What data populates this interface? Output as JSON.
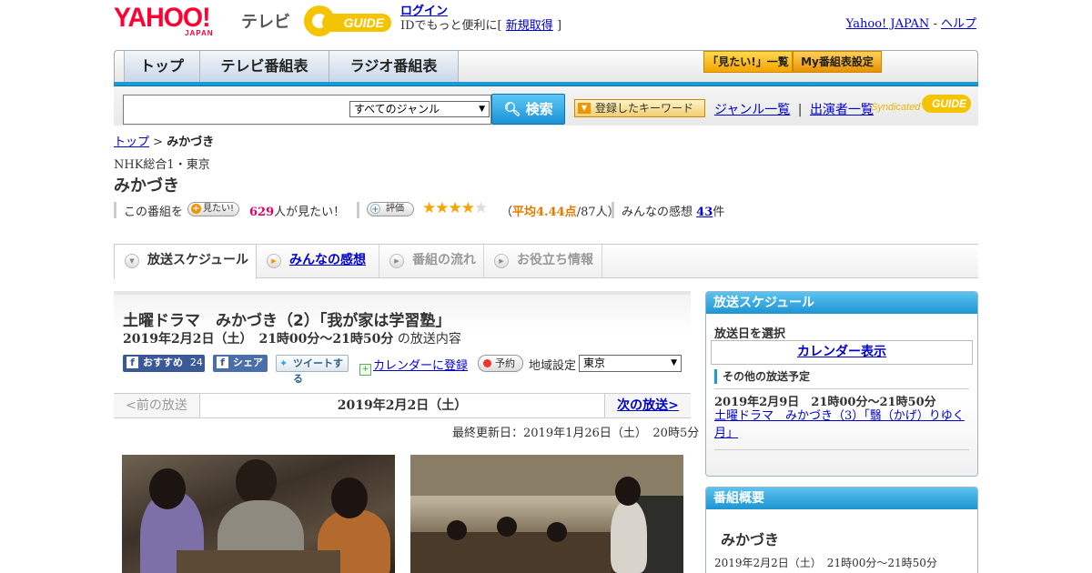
{
  "header": {
    "logo_text": "YAHOO!",
    "logo_sub": "JAPAN",
    "tv_label": "テレビ",
    "gguide_label": "GUIDE",
    "login_link": "ログイン",
    "id_prompt_prefix": "IDでもっと便利に[",
    "register_link": "新規取得",
    "id_prompt_suffix": "]",
    "yahoo_japan_link": "Yahoo! JAPAN",
    "link_sep": "-",
    "help_link": "ヘルプ"
  },
  "nav": {
    "tabs": [
      {
        "label": "トップ"
      },
      {
        "label": "テレビ番組表"
      },
      {
        "label": "ラジオ番組表"
      }
    ],
    "watchlist_button": "「見たい!」一覧",
    "my_schedule_button": "My番組表設定"
  },
  "search": {
    "placeholder": "",
    "genre_selected": "すべてのジャンル",
    "search_button": "検索",
    "keyword_button": "登録したキーワード",
    "genre_list_link": "ジャンル一覧",
    "sep": "|",
    "cast_list_link": "出演者一覧",
    "syndicated_label": "Syndicated",
    "syndicated_logo": "GUIDE"
  },
  "breadcrumb": {
    "top_link": "トップ",
    "sep": ">",
    "current": "みかづき"
  },
  "program": {
    "channel": "NHK総合1・東京",
    "title": "みかづき",
    "watch_prefix": "この番組を",
    "watch_chip": "見たい!",
    "watch_count": "629",
    "watch_suffix": "人が見たい！",
    "rating_chip": "評価",
    "rating_value": 4.44,
    "rating_stars_filled": 4,
    "rating_open": "（",
    "rating_avg_text": "平均4.44点",
    "rating_count_text": "/87人）",
    "reviews_prefix": "みんなの感想",
    "reviews_count": "43",
    "reviews_suffix": "件"
  },
  "tabs": [
    {
      "label": "放送スケジュール"
    },
    {
      "label": "みんなの感想"
    },
    {
      "label": "番組の流れ"
    },
    {
      "label": "お役立ち情報"
    }
  ],
  "episode": {
    "title": "土曜ドラマ　みかづき（2）「我が家は学習塾」",
    "datetime": "2019年2月2日（土）　21時00分～21時50分",
    "datetime_suffix": "の放送内容",
    "fb_recommend": "おすすめ",
    "fb_count": "24",
    "fb_share": "シェア",
    "tweet": "ツイートする",
    "calendar_link": "カレンダーに登録",
    "reserve": "予約",
    "region_label": "地域設定",
    "region_selected": "東京",
    "prev_link": "<前の放送",
    "current_date": "2019年2月2日（土）",
    "next_link": "次の放送>",
    "updated": "最終更新日：2019年1月26日（土）　20時5分"
  },
  "sidebar": {
    "schedule_head": "放送スケジュール",
    "select_date": "放送日を選択",
    "calendar_link": "カレンダー表示",
    "other_schedule": "その他の放送予定",
    "next_when": "2019年2月9日　21時00分～21時50分",
    "next_title": "土曜ドラマ　みかづき（3）「翳（かげ）りゆく月」",
    "summary_head": "番組概要",
    "summary_name": "みかづき",
    "summary_dt": "2019年2月2日（土）　21時00分～21時50分"
  },
  "colors": {
    "accent_blue": "#1a9cd9",
    "yahoo_red": "#ff0033",
    "gguide_yellow": "#f5c400",
    "star": "#f5a400",
    "watch_count": "#e0006a"
  }
}
